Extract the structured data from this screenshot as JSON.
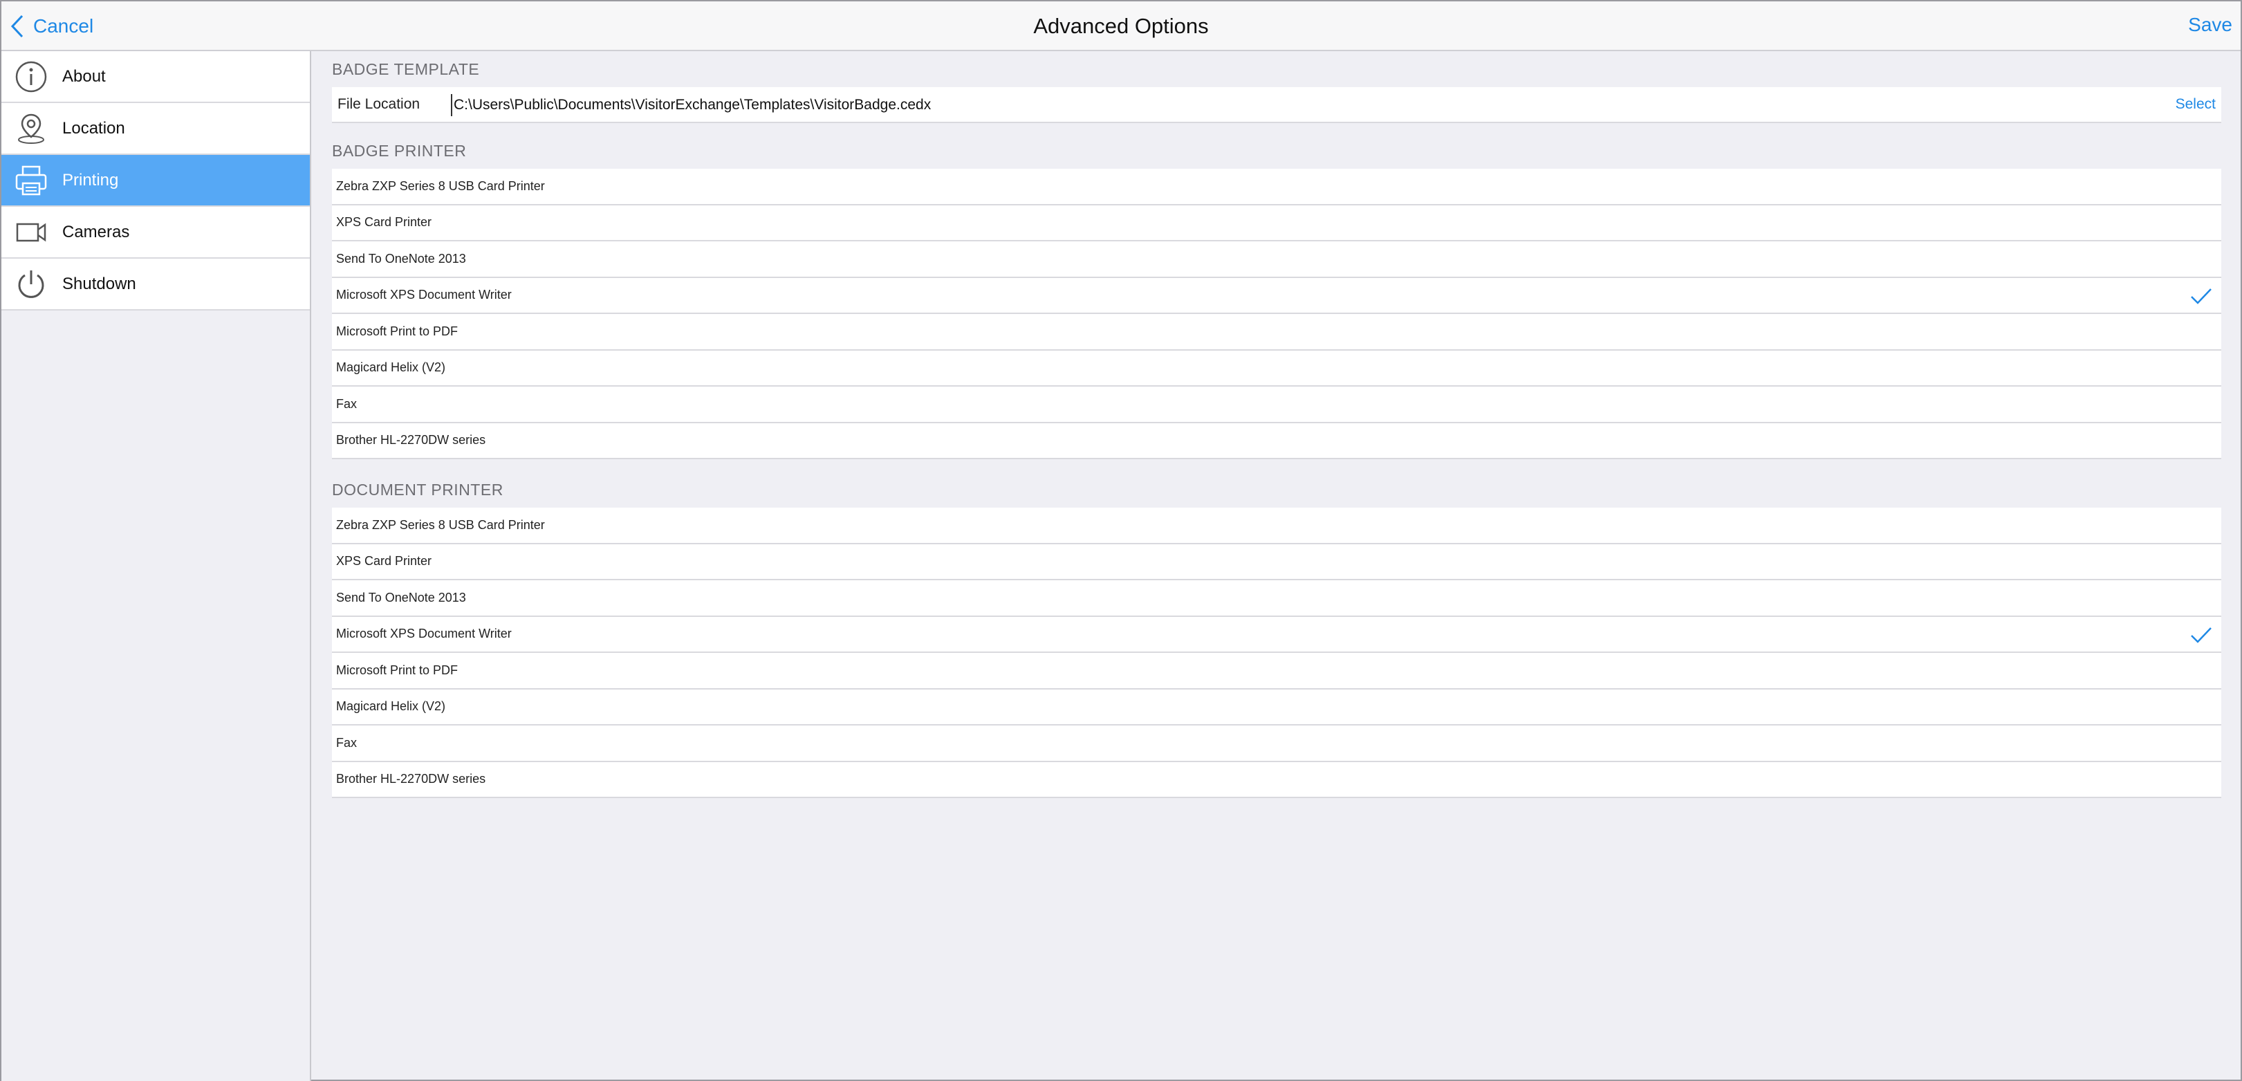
{
  "header": {
    "cancel_label": "Cancel",
    "title": "Advanced Options",
    "save_label": "Save"
  },
  "sidebar": {
    "items": [
      {
        "label": "About",
        "icon": "info-icon",
        "active": false
      },
      {
        "label": "Location",
        "icon": "location-pin-icon",
        "active": false
      },
      {
        "label": "Printing",
        "icon": "printer-icon",
        "active": true
      },
      {
        "label": "Cameras",
        "icon": "camera-icon",
        "active": false
      },
      {
        "label": "Shutdown",
        "icon": "power-icon",
        "active": false
      }
    ]
  },
  "badge_template": {
    "section_title": "BADGE TEMPLATE",
    "file_location_label": "File Location",
    "file_location_value": "C:\\Users\\Public\\Documents\\VisitorExchange\\Templates\\VisitorBadge.cedx",
    "select_label": "Select"
  },
  "badge_printer": {
    "section_title": "BADGE PRINTER",
    "printers": [
      {
        "name": "Zebra ZXP Series 8 USB Card Printer",
        "selected": false
      },
      {
        "name": "XPS Card Printer",
        "selected": false
      },
      {
        "name": "Send To OneNote 2013",
        "selected": false
      },
      {
        "name": "Microsoft XPS Document Writer",
        "selected": true
      },
      {
        "name": "Microsoft Print to PDF",
        "selected": false
      },
      {
        "name": "Magicard Helix (V2)",
        "selected": false
      },
      {
        "name": "Fax",
        "selected": false
      },
      {
        "name": "Brother HL-2270DW series",
        "selected": false
      }
    ]
  },
  "document_printer": {
    "section_title": "DOCUMENT PRINTER",
    "printers": [
      {
        "name": "Zebra ZXP Series 8 USB Card Printer",
        "selected": false
      },
      {
        "name": "XPS Card Printer",
        "selected": false
      },
      {
        "name": "Send To OneNote 2013",
        "selected": false
      },
      {
        "name": "Microsoft XPS Document Writer",
        "selected": true
      },
      {
        "name": "Microsoft Print to PDF",
        "selected": false
      },
      {
        "name": "Magicard Helix (V2)",
        "selected": false
      },
      {
        "name": "Fax",
        "selected": false
      },
      {
        "name": "Brother HL-2270DW series",
        "selected": false
      }
    ]
  },
  "colors": {
    "accent": "#1e88e5",
    "active_nav": "#56a8f5",
    "background": "#efeff4"
  }
}
